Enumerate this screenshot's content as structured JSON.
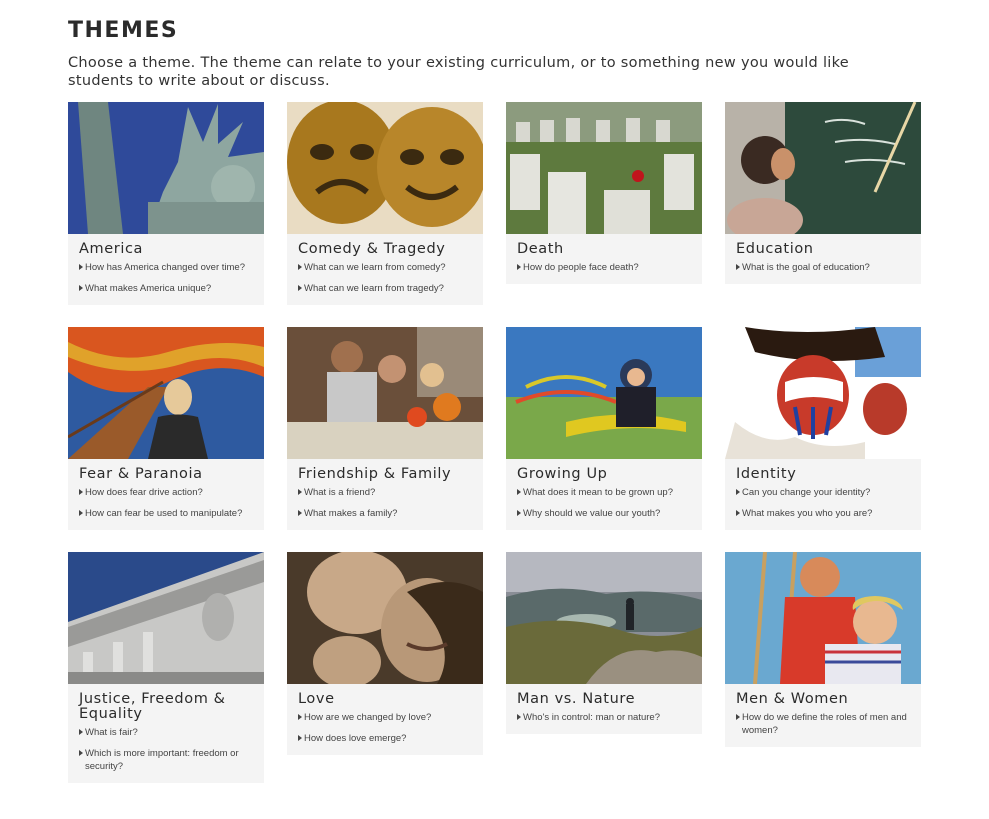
{
  "heading": "THEMES",
  "intro": "Choose a theme. The theme can relate to your existing curriculum, or to something new you would like students to write about or discuss.",
  "themes": [
    {
      "title": "America",
      "questions": [
        "How has America changed over time?",
        "What makes America unique?"
      ]
    },
    {
      "title": "Comedy & Tragedy",
      "questions": [
        "What can we learn from comedy?",
        "What can we learn from tragedy?"
      ]
    },
    {
      "title": "Death",
      "questions": [
        "How do people face death?"
      ]
    },
    {
      "title": "Education",
      "questions": [
        "What is the goal of education?"
      ]
    },
    {
      "title": "Fear & Paranoia",
      "questions": [
        "How does fear drive action?",
        "How can fear be used to manipulate?"
      ]
    },
    {
      "title": "Friendship & Family",
      "questions": [
        "What is a friend?",
        "What makes a family?"
      ]
    },
    {
      "title": "Growing Up",
      "questions": [
        "What does it mean to be grown up?",
        "Why should we value our youth?"
      ]
    },
    {
      "title": "Identity",
      "questions": [
        "Can you change your identity?",
        "What makes you who you are?"
      ]
    },
    {
      "title": "Justice, Freedom & Equality",
      "questions": [
        "What is fair?",
        "Which is more important: freedom or security?"
      ]
    },
    {
      "title": "Love",
      "questions": [
        "How are we changed by love?",
        "How does love emerge?"
      ]
    },
    {
      "title": "Man vs. Nature",
      "questions": [
        "Who's in control: man or nature?"
      ]
    },
    {
      "title": "Men & Women",
      "questions": [
        "How do we define the roles of men and women?"
      ]
    }
  ]
}
